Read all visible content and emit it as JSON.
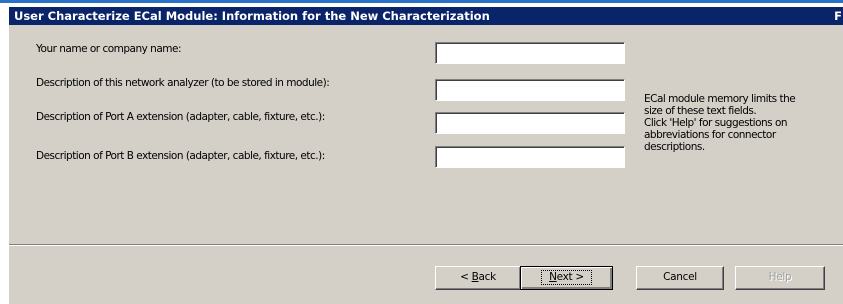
{
  "dialog": {
    "title": "User Characterize ECal Module: Information for the New Characterization",
    "title_edge_char": "F"
  },
  "fields": [
    {
      "label": "Your name or company name:",
      "value": ""
    },
    {
      "label": "Description of this network analyzer (to be stored in module):",
      "value": ""
    },
    {
      "label": "Description of Port A extension (adapter, cable, fixture, etc.):",
      "value": ""
    },
    {
      "label": "Description of Port B extension (adapter, cable, fixture, etc.):",
      "value": ""
    }
  ],
  "info": {
    "lines": [
      "ECal module memory limits the",
      "size of these text fields.",
      "Click 'Help' for suggestions on",
      "abbreviations for connector",
      "descriptions."
    ]
  },
  "buttons": {
    "back": {
      "prefix": "< ",
      "mnemonic": "B",
      "rest": "ack"
    },
    "next": {
      "mnemonic": "N",
      "rest": "ext >"
    },
    "cancel": {
      "label": "Cancel"
    },
    "help": {
      "label": "Help",
      "enabled": false
    }
  },
  "colors": {
    "title_bar": "#0a246a",
    "dialog_face": "#d4d0c8",
    "page_accent": "#2a72c8"
  }
}
